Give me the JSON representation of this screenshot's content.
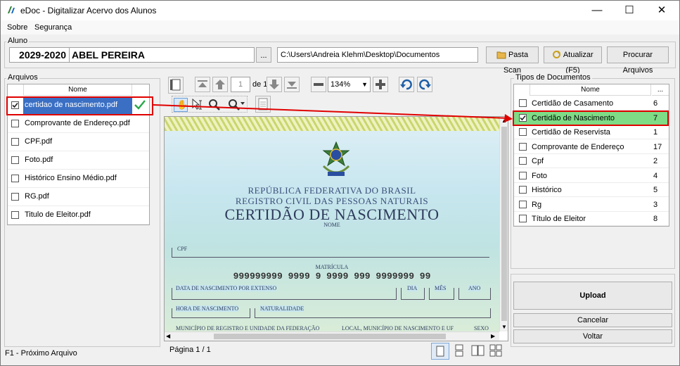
{
  "window": {
    "title": "eDoc - Digitalizar Acervo dos Alunos",
    "minimize": "—",
    "maximize": "☐",
    "close": "✕"
  },
  "menu": [
    {
      "label": "Sobre"
    },
    {
      "label": "Segurança"
    }
  ],
  "aluno": {
    "group_label": "Aluno",
    "code": "2029-2020",
    "name": "ABEL PEREIRA",
    "browse_label": "...",
    "path": "C:\\Users\\Andreia Klehm\\Desktop\\Documentos"
  },
  "toolbar": {
    "pasta_scan": "Pasta Scan",
    "atualizar": "Atualizar (F5)",
    "procurar": "Procurar Arquivos"
  },
  "arquivos": {
    "group_label": "Arquivos",
    "column": "Nome",
    "items": [
      {
        "name": "certidao de nascimento.pdf",
        "checked": true,
        "selected": true
      },
      {
        "name": "Comprovante de Endereço.pdf",
        "checked": false
      },
      {
        "name": "CPF.pdf",
        "checked": false
      },
      {
        "name": "Foto.pdf",
        "checked": false
      },
      {
        "name": "Histórico Ensino Médio.pdf",
        "checked": false
      },
      {
        "name": "RG.pdf",
        "checked": false
      },
      {
        "name": "Titulo de Eleitor.pdf",
        "checked": false
      }
    ]
  },
  "viewer": {
    "page_value": "1",
    "page_of": "de 1",
    "zoom": "134%",
    "page_status": "Página 1 / 1"
  },
  "certidao": {
    "line1": "REPÚBLICA FEDERATIVA DO BRASIL",
    "line2": "REGISTRO CIVIL DAS PESSOAS NATURAIS",
    "heading": "CERTIDÃO DE NASCIMENTO",
    "nome": "NOME",
    "cpf": "CPF",
    "matricula_label": "MATRÍCULA",
    "matricula": "999999999 9999 9 9999 999 9999999 99",
    "data_nasc": "DATA DE NASCIMENTO POR EXTENSO",
    "dia": "DIA",
    "mes": "MÊS",
    "ano": "ANO",
    "hora": "HORA DE NASCIMENTO",
    "naturalidade": "NATURALIDADE",
    "municipio": "MUNICÍPIO DE REGISTRO E UNIDADE DA FEDERAÇÃO",
    "local": "LOCAL, MUNICÍPIO DE NASCIMENTO E UF",
    "sexo": "SEXO"
  },
  "tipos": {
    "group_label": "Tipos de Documentos",
    "column": "Nome",
    "column2": "...",
    "items": [
      {
        "name": "Certidão de Casamento",
        "count": "6",
        "checked": false
      },
      {
        "name": "Certidão de Nascimento",
        "count": "7",
        "checked": true,
        "selected": true
      },
      {
        "name": "Certidão de Reservista",
        "count": "1",
        "checked": false
      },
      {
        "name": "Comprovante de Endereço",
        "count": "17",
        "checked": false
      },
      {
        "name": "Cpf",
        "count": "2",
        "checked": false
      },
      {
        "name": "Foto",
        "count": "4",
        "checked": false
      },
      {
        "name": "Histórico",
        "count": "5",
        "checked": false
      },
      {
        "name": "Rg",
        "count": "3",
        "checked": false
      },
      {
        "name": "Título de Eleitor",
        "count": "8",
        "checked": false
      }
    ]
  },
  "actions": {
    "upload": "Upload",
    "cancelar": "Cancelar",
    "voltar": "Voltar"
  },
  "status": {
    "hint": "F1 - Próximo Arquivo"
  },
  "colors": {
    "selected_row": "#3a6fc4",
    "highlight_green": "#7edb86",
    "annotation_red": "#e00000"
  }
}
